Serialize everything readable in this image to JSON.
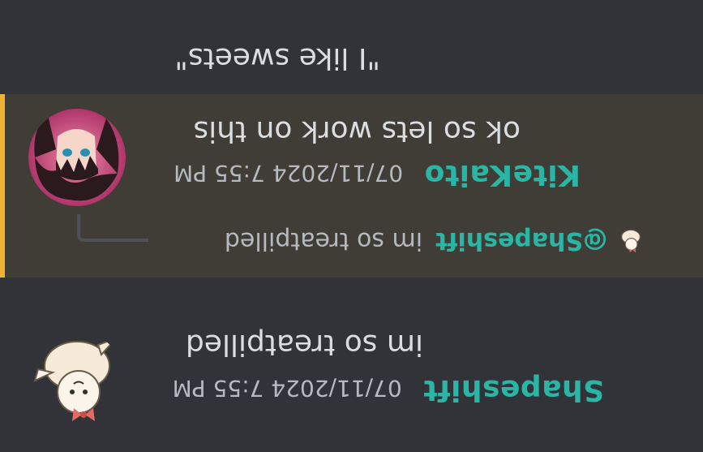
{
  "messages": [
    {
      "username": "Shapeshift",
      "timestamp": "07/11/2024 7:55 PM",
      "text": "im so treatpilled"
    },
    {
      "reply": {
        "mention": "@Shapeshift",
        "text": "im so treatpilled"
      },
      "username": "KiteKaito",
      "timestamp": "07/11/2024 7:55 PM",
      "text": "ok so lets work on this",
      "highlight_color": "#f0b232"
    },
    {
      "text": "\"I like sweets\""
    }
  ],
  "colors": {
    "background": "#313338",
    "highlight_background": "#3f3d36",
    "username": "#2bb5a4",
    "timestamp": "#b5bac1"
  }
}
